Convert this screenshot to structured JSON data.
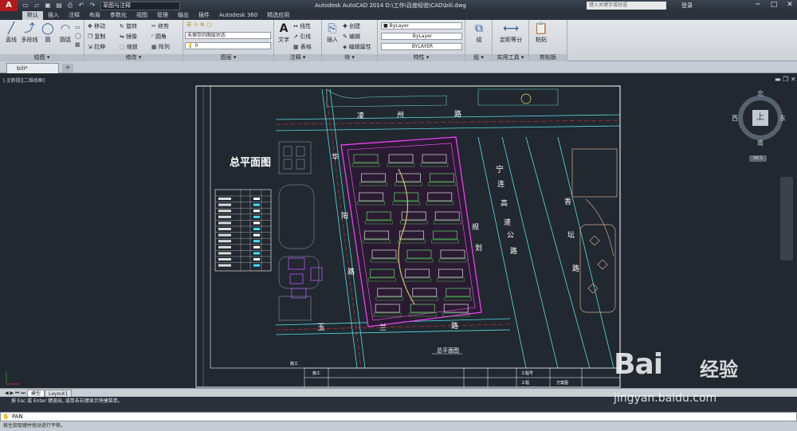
{
  "titlebar": {
    "app_logo": "A",
    "workspace": "草图与注释",
    "title": "Autodesk AutoCAD 2014    D:\\工作\\百度经验\\CAD\\bili.dwg",
    "search_placeholder": "键入关键字或短语",
    "login": "登录",
    "minimize": "─",
    "maximize": "□",
    "close": "✕"
  },
  "tabs": [
    "默认",
    "插入",
    "注释",
    "布局",
    "参数化",
    "视图",
    "管理",
    "输出",
    "插件",
    "Autodesk 360",
    "精选应用"
  ],
  "ribbon": {
    "draw": {
      "title": "绘图 ▾",
      "line": "直线",
      "polyline": "多段线",
      "circle": "圆",
      "arc": "圆弧"
    },
    "modify": {
      "title": "修改 ▾",
      "move": "移动",
      "rotate": "旋转",
      "trim": "修剪",
      "copy": "复制",
      "mirror": "镜像",
      "fillet": "圆角",
      "stretch": "拉伸",
      "scale": "缩放",
      "array": "阵列"
    },
    "layers": {
      "title": "图层 ▾",
      "state": "未保存的图层状态",
      "current": "0"
    },
    "annotation": {
      "title": "注释 ▾",
      "text": "文字",
      "linear": "线性",
      "leader": "引线",
      "table": "表格"
    },
    "block": {
      "title": "块 ▾",
      "insert": "插入",
      "create": "创建",
      "edit": "编辑",
      "attr": "编辑属性"
    },
    "properties": {
      "title": "特性 ▾",
      "color": "ByLayer",
      "linetype": "ByLayer",
      "lineweight": "BYLAYER"
    },
    "groups": {
      "title": "组 ▾",
      "group": "组"
    },
    "utilities": {
      "title": "实用工具 ▾",
      "measure": "测量",
      "quick": "定距等分"
    },
    "clipboard": {
      "title": "剪贴板",
      "paste": "粘贴"
    }
  },
  "doc_tab": "bili*",
  "viewport_label": "[-][俯视][二维线框]",
  "viewcube": {
    "north": "北",
    "south": "南",
    "east": "东",
    "west": "西",
    "top": "上",
    "wcs": "WCS"
  },
  "drawing": {
    "title": "总平面图",
    "sub_title": "总平面图",
    "road_top": [
      "凌",
      "州",
      "路"
    ],
    "road_right": [
      "宁",
      "连",
      "高",
      "速",
      "公",
      "路"
    ],
    "road_far": [
      "香",
      "坛",
      "路"
    ],
    "road_left": [
      "华",
      "阳",
      "路"
    ],
    "road_bottom": [
      "玉",
      "兰",
      "路"
    ],
    "road_mid": [
      "规",
      "划",
      "路"
    ],
    "titleblock": {
      "a": "施工",
      "b": "工程",
      "c": "工程号",
      "d": "方案图"
    }
  },
  "layouts": {
    "model": "模型",
    "layout1": "Layout1"
  },
  "command_history": "按 Esc 或 Enter 键退出, 或单击右键显示快捷菜单。",
  "command_line": "PAN",
  "status_text": "按住拾取键并拖动进行平移。",
  "watermark": {
    "brand": "Bai",
    "jingyan": "经验",
    "url": "jingyan.baidu.com"
  }
}
